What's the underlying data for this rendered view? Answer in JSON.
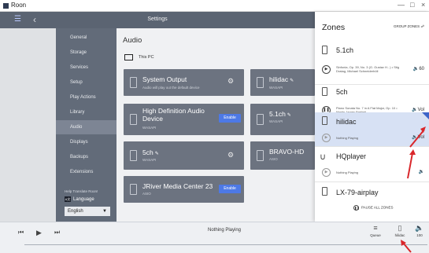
{
  "window": {
    "title": "Roon",
    "minimize": "—",
    "maximize": "□",
    "close": "×"
  },
  "topbar": {
    "title": "Settings",
    "menu_icon": "hamburger-icon",
    "back_icon": "back-arrow-icon"
  },
  "sidebar": {
    "items": [
      {
        "label": "General"
      },
      {
        "label": "Storage"
      },
      {
        "label": "Services"
      },
      {
        "label": "Setup"
      },
      {
        "label": "Play Actions"
      },
      {
        "label": "Library"
      },
      {
        "label": "Audio",
        "active": true
      },
      {
        "label": "Displays"
      },
      {
        "label": "Backups"
      },
      {
        "label": "Extensions"
      }
    ],
    "help_text": "Help Translate Roon!",
    "language_label": "Language",
    "language_icon_text": "A文",
    "language_value": "English"
  },
  "main": {
    "title": "Audio",
    "pc_label": "This PC",
    "cards": [
      {
        "name": "System Output",
        "sub": "Audio will play out the default device",
        "action": "settings",
        "pencil": false
      },
      {
        "name": "hilidac",
        "sub": "WASAPI",
        "action": "none",
        "pencil": true
      },
      {
        "name": "High Definition Audio Device",
        "sub": "WASAPI",
        "action": "Enable",
        "pencil": false
      },
      {
        "name": "5.1ch",
        "sub": "WASAPI",
        "action": "none",
        "pencil": true
      },
      {
        "name": "5ch",
        "sub": "WASAPI",
        "action": "settings",
        "pencil": true
      },
      {
        "name": "BRAVO-HD",
        "sub": "ASIO",
        "action": "none",
        "pencil": false
      },
      {
        "name": "JRiver Media Center 23",
        "sub": "ASIO",
        "action": "Enable",
        "pencil": false
      }
    ]
  },
  "zones": {
    "title": "Zones",
    "group_label": "GROUP ZONES",
    "list": [
      {
        "name": "5.1ch",
        "now_playing": "Sinfonia, Op. 39, No. 3 (G. Gustav H...) • Stig Dratag, Michael Schneiderhöll",
        "volume": "60",
        "state": "playing"
      },
      {
        "name": "5ch",
        "now_playing": "Piano Sonata No. 7 in A Flat Major, Op. 10 • Martin James Bartlett",
        "volume": "Vol",
        "state": "paused"
      },
      {
        "name": "hilidac",
        "now_playing": "Nothing Playing",
        "volume": "Vol",
        "state": "idle",
        "selected": true
      },
      {
        "name": "HQplayer",
        "now_playing": "Nothing Playing",
        "volume": "",
        "state": "idle"
      },
      {
        "name": "LX-79-airplay",
        "now_playing": "",
        "volume": "",
        "state": "idle"
      }
    ],
    "pause_all": "PAUSE ALL ZONES"
  },
  "player": {
    "now_playing": "Nothing Playing",
    "queue_label": "Queue",
    "zone_label": "hilidac",
    "volume_label": "100"
  },
  "colors": {
    "accent": "#4d79e6",
    "annotation": "#d9262a",
    "card": "#6c7380",
    "sidebar": "#626b79"
  }
}
